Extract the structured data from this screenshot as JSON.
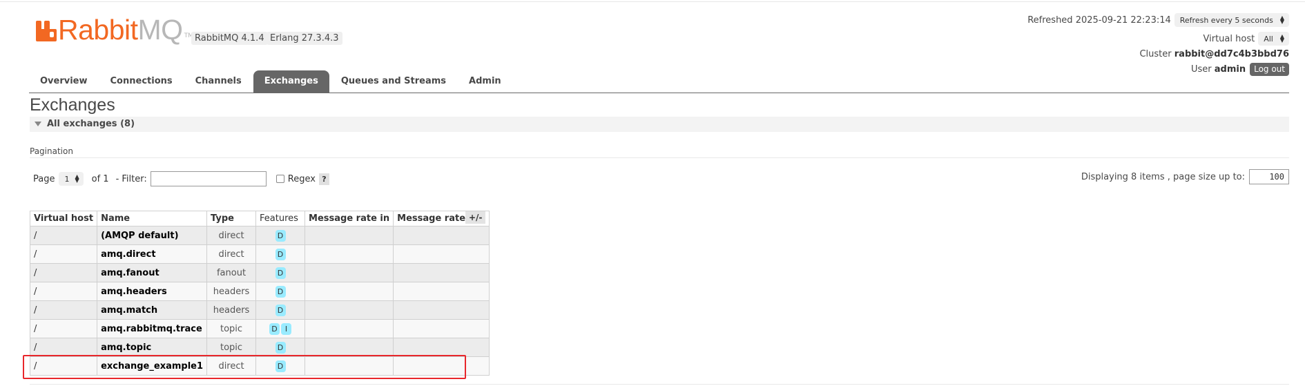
{
  "brand": {
    "name_part1": "Rabbit",
    "name_part2": "MQ",
    "tm": "TM",
    "logo_color": "#f26822",
    "version_badge": "RabbitMQ 4.1.4",
    "erlang_badge": "Erlang 27.3.4.3"
  },
  "header": {
    "refreshed_label": "Refreshed 2025-09-21 22:23:14",
    "refresh_select": "Refresh every 5 seconds",
    "vhost_label": "Virtual host",
    "vhost_select": "All",
    "cluster_label": "Cluster",
    "cluster_name": "rabbit@dd7c4b3bbd76",
    "user_label": "User",
    "user_name": "admin",
    "logout": "Log out"
  },
  "tabs": [
    {
      "label": "Overview",
      "active": false
    },
    {
      "label": "Connections",
      "active": false
    },
    {
      "label": "Channels",
      "active": false
    },
    {
      "label": "Exchanges",
      "active": true
    },
    {
      "label": "Queues and Streams",
      "active": false
    },
    {
      "label": "Admin",
      "active": false
    }
  ],
  "page": {
    "title": "Exchanges",
    "section_label": "All exchanges (8)",
    "pagination_label": "Pagination"
  },
  "pager": {
    "page_label": "Page",
    "page_value": "1",
    "of_label": "of 1",
    "filter_label": "- Filter:",
    "filter_value": "",
    "regex_label": "Regex",
    "help": "?",
    "displaying_label": "Displaying 8 items , page size up to:",
    "page_size": "100"
  },
  "table": {
    "columns": [
      "Virtual host",
      "Name",
      "Type",
      "Features",
      "Message rate in",
      "Message rate out"
    ],
    "toggle_columns": "+/-",
    "rows": [
      {
        "vhost": "/",
        "name": "(AMQP default)",
        "type": "direct",
        "features": [
          "D"
        ],
        "rate_in": "",
        "rate_out": ""
      },
      {
        "vhost": "/",
        "name": "amq.direct",
        "type": "direct",
        "features": [
          "D"
        ],
        "rate_in": "",
        "rate_out": ""
      },
      {
        "vhost": "/",
        "name": "amq.fanout",
        "type": "fanout",
        "features": [
          "D"
        ],
        "rate_in": "",
        "rate_out": ""
      },
      {
        "vhost": "/",
        "name": "amq.headers",
        "type": "headers",
        "features": [
          "D"
        ],
        "rate_in": "",
        "rate_out": ""
      },
      {
        "vhost": "/",
        "name": "amq.match",
        "type": "headers",
        "features": [
          "D"
        ],
        "rate_in": "",
        "rate_out": ""
      },
      {
        "vhost": "/",
        "name": "amq.rabbitmq.trace",
        "type": "topic",
        "features": [
          "D",
          "I"
        ],
        "rate_in": "",
        "rate_out": ""
      },
      {
        "vhost": "/",
        "name": "amq.topic",
        "type": "topic",
        "features": [
          "D"
        ],
        "rate_in": "",
        "rate_out": ""
      },
      {
        "vhost": "/",
        "name": "exchange_example1",
        "type": "direct",
        "features": [
          "D"
        ],
        "rate_in": "",
        "rate_out": ""
      }
    ]
  },
  "colors": {
    "tab_active_bg": "#666666",
    "feature_badge": "#99ebff",
    "highlight_border": "#e8262b"
  }
}
